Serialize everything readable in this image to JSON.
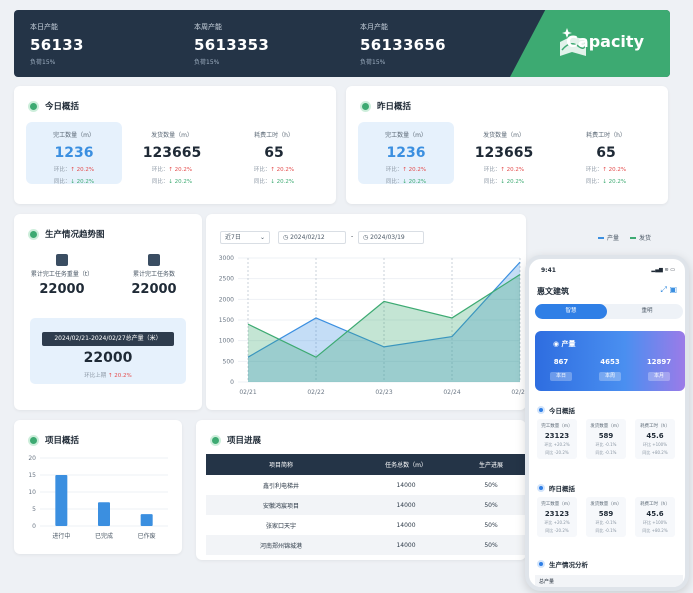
{
  "top": {
    "kpis": [
      {
        "label": "本日产能",
        "value": "56133",
        "sub": "负荷15%"
      },
      {
        "label": "本周产能",
        "value": "5613353",
        "sub": "负荷15%"
      },
      {
        "label": "本月产能",
        "value": "56133656",
        "sub": "负荷15%"
      }
    ],
    "capacity_label": "Capacity"
  },
  "today": {
    "title": "今日概括",
    "metrics": [
      {
        "label": "完工数量（m）",
        "value": "1236",
        "r1_label": "环比：",
        "r1": "↑ 20.2%",
        "r2_label": "同比：",
        "r2": "↓ 20.2%"
      },
      {
        "label": "发货数量（m）",
        "value": "123665",
        "r1_label": "环比：",
        "r1": "↑ 20.2%",
        "r2_label": "同比：",
        "r2": "↓ 20.2%"
      },
      {
        "label": "耗费工时（h）",
        "value": "65",
        "r1_label": "环比：",
        "r1": "↑ 20.2%",
        "r2_label": "同比：",
        "r2": "↓ 20.2%"
      }
    ]
  },
  "yesterday": {
    "title": "昨日概括",
    "metrics": [
      {
        "label": "完工数量（m）",
        "value": "1236",
        "r1_label": "环比：",
        "r1": "↑ 20.2%",
        "r2_label": "同比：",
        "r2": "↓ 20.2%"
      },
      {
        "label": "发货数量（m）",
        "value": "123665",
        "r1_label": "环比：",
        "r1": "↑ 20.2%",
        "r2_label": "同比：",
        "r2": "↓ 20.2%"
      },
      {
        "label": "耗费工时（h）",
        "value": "65",
        "r1_label": "环比：",
        "r1": "↑ 20.2%",
        "r2_label": "同比：",
        "r2": "↓ 20.2%"
      }
    ]
  },
  "trend": {
    "title": "生产情况趋势图",
    "acc1": {
      "label": "累计完工任务重量（t）",
      "value": "22000",
      "icon": "weight-icon"
    },
    "acc2": {
      "label": "累计完工任务数",
      "value": "22000",
      "icon": "task-icon"
    },
    "range_label": "2024/02/21-2024/02/27总产量（米）",
    "range_value": "22000",
    "range_rt_label": "环比上期",
    "range_rt": "↑ 20.2%",
    "period_select": "近7日",
    "date_start": "2024/02/12",
    "date_sep": "-",
    "date_end": "2024/03/19",
    "legend": [
      "产量",
      "发货"
    ]
  },
  "chart_data": {
    "type": "area",
    "categories": [
      "02/21",
      "02/22",
      "02/23",
      "02/24",
      "02/25"
    ],
    "series": [
      {
        "name": "产量",
        "values": [
          600,
          1550,
          850,
          1100,
          2900
        ]
      },
      {
        "name": "发货",
        "values": [
          1400,
          600,
          1950,
          1550,
          2600
        ]
      }
    ],
    "ylim": [
      0,
      3000
    ],
    "yticks": [
      0,
      500,
      1000,
      1500,
      2000,
      2500,
      3000
    ]
  },
  "project_overview": {
    "title": "项目概括",
    "bars": {
      "categories": [
        "进行中",
        "已完成",
        "已作废"
      ],
      "values": [
        15,
        7,
        3.5
      ],
      "yticks": [
        0,
        5,
        10,
        15,
        20
      ]
    }
  },
  "project_progress": {
    "title": "项目进展",
    "headers": [
      "项目简称",
      "任务总数（m）",
      "生产进展"
    ],
    "rows": [
      [
        "鑫引利电梯井",
        "14000",
        "50%"
      ],
      [
        "安徽鸿宸项目",
        "14000",
        "50%"
      ],
      [
        "张家口天宇",
        "14000",
        "50%"
      ],
      [
        "河南郑州锦城港",
        "14000",
        "50%"
      ]
    ]
  },
  "phone": {
    "time": "9:41",
    "status": "▂▄▆ ≋ ▭",
    "title": "惠文建筑",
    "tabs": [
      "智慧",
      "重明"
    ],
    "band_title": "产量",
    "band_values": [
      "867",
      "4653",
      "12897"
    ],
    "band_tags": [
      "本日",
      "本周",
      "本月"
    ],
    "today_title": "今日概括",
    "yesterday_title": "昨日概括",
    "analysis_title": "生产情况分析",
    "footer": "总产量",
    "today_metrics": [
      {
        "label": "完工数量（m）",
        "value": "23123",
        "r1": "环比 +20.2%",
        "r2": "同比 -20.2%"
      },
      {
        "label": "发货数量（m）",
        "value": "589",
        "r1": "环比 -0.1%",
        "r2": "同比 -0.1%"
      },
      {
        "label": "耗费工时（h）",
        "value": "45.6",
        "r1": "环比 +100%",
        "r2": "同比 +80.2%"
      }
    ],
    "yesterday_metrics": [
      {
        "label": "完工数量（m）",
        "value": "23123",
        "r1": "环比 +20.2%",
        "r2": "同比 -20.2%"
      },
      {
        "label": "发货数量（m）",
        "value": "589",
        "r1": "环比 -0.1%",
        "r2": "同比 -0.1%"
      },
      {
        "label": "耗费工时（h）",
        "value": "45.6",
        "r1": "环比 +100%",
        "r2": "同比 +80.2%"
      }
    ]
  },
  "colors": {
    "accent_green": "#3daa72",
    "accent_blue": "#3b8fe0",
    "navy": "#243447"
  }
}
